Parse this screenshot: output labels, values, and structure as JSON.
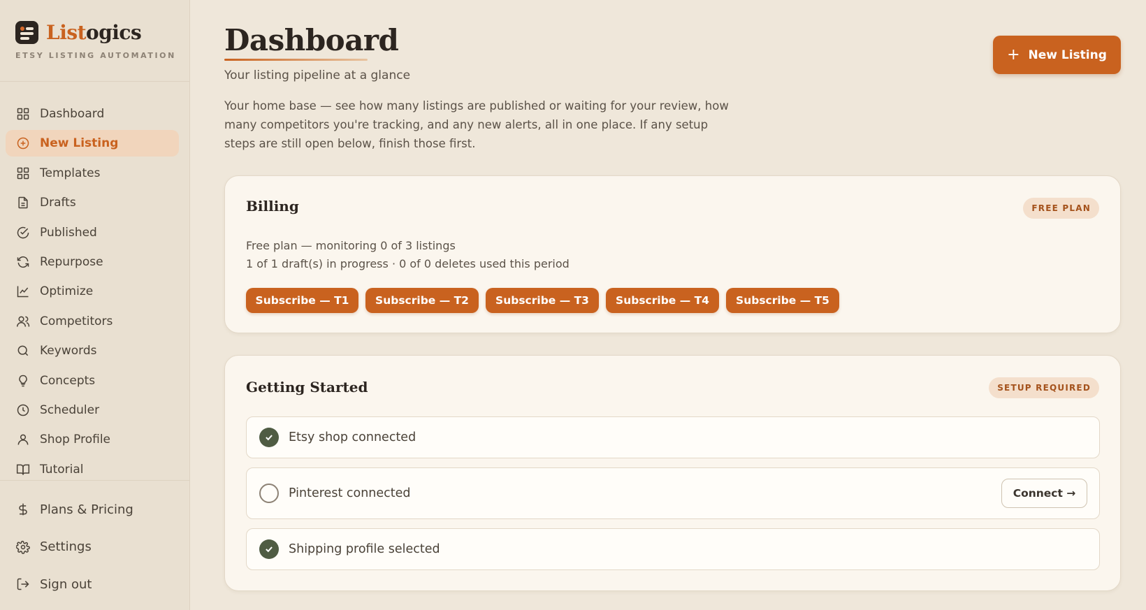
{
  "brand": {
    "name_accent": "List",
    "name_rest": "ogics",
    "tagline": "ETSY LISTING AUTOMATION",
    "accent_color": "#c9621f"
  },
  "sidebar": {
    "items": [
      {
        "label": "Dashboard",
        "icon": "grid-icon"
      },
      {
        "label": "New Listing",
        "icon": "plus-circle-icon",
        "active": true
      },
      {
        "label": "Templates",
        "icon": "grid-icon"
      },
      {
        "label": "Drafts",
        "icon": "document-icon"
      },
      {
        "label": "Published",
        "icon": "check-circle-icon"
      },
      {
        "label": "Repurpose",
        "icon": "refresh-icon"
      },
      {
        "label": "Optimize",
        "icon": "line-chart-icon"
      },
      {
        "label": "Competitors",
        "icon": "users-icon"
      },
      {
        "label": "Keywords",
        "icon": "search-icon"
      },
      {
        "label": "Concepts",
        "icon": "lightbulb-icon"
      },
      {
        "label": "Scheduler",
        "icon": "clock-icon"
      },
      {
        "label": "Shop Profile",
        "icon": "user-icon"
      },
      {
        "label": "Tutorial",
        "icon": "book-icon"
      }
    ],
    "bottom_items": [
      {
        "label": "Plans & Pricing",
        "icon": "dollar-icon"
      },
      {
        "label": "Settings",
        "icon": "gear-icon"
      },
      {
        "label": "Sign out",
        "icon": "sign-out-icon"
      }
    ]
  },
  "header": {
    "title": "Dashboard",
    "subtitle": "Your listing pipeline at a glance",
    "description": "Your home base — see how many listings are published or waiting for your review, how many competitors you're tracking, and any new alerts, all in one place. If any setup steps are still open below, finish those first.",
    "new_listing_label": "New Listing"
  },
  "billing": {
    "title": "Billing",
    "badge": "FREE PLAN",
    "line1": "Free plan — monitoring 0 of 3 listings",
    "line2": "1 of 1 draft(s) in progress · 0 of 0 deletes used this period",
    "subscribe_buttons": [
      "Subscribe — T1",
      "Subscribe — T2",
      "Subscribe — T3",
      "Subscribe — T4",
      "Subscribe — T5"
    ]
  },
  "getting_started": {
    "title": "Getting Started",
    "badge": "SETUP REQUIRED",
    "steps": [
      {
        "label": "Etsy shop connected",
        "done": true
      },
      {
        "label": "Pinterest connected",
        "done": false,
        "action": "Connect →"
      },
      {
        "label": "Shipping profile selected",
        "done": true
      }
    ]
  }
}
